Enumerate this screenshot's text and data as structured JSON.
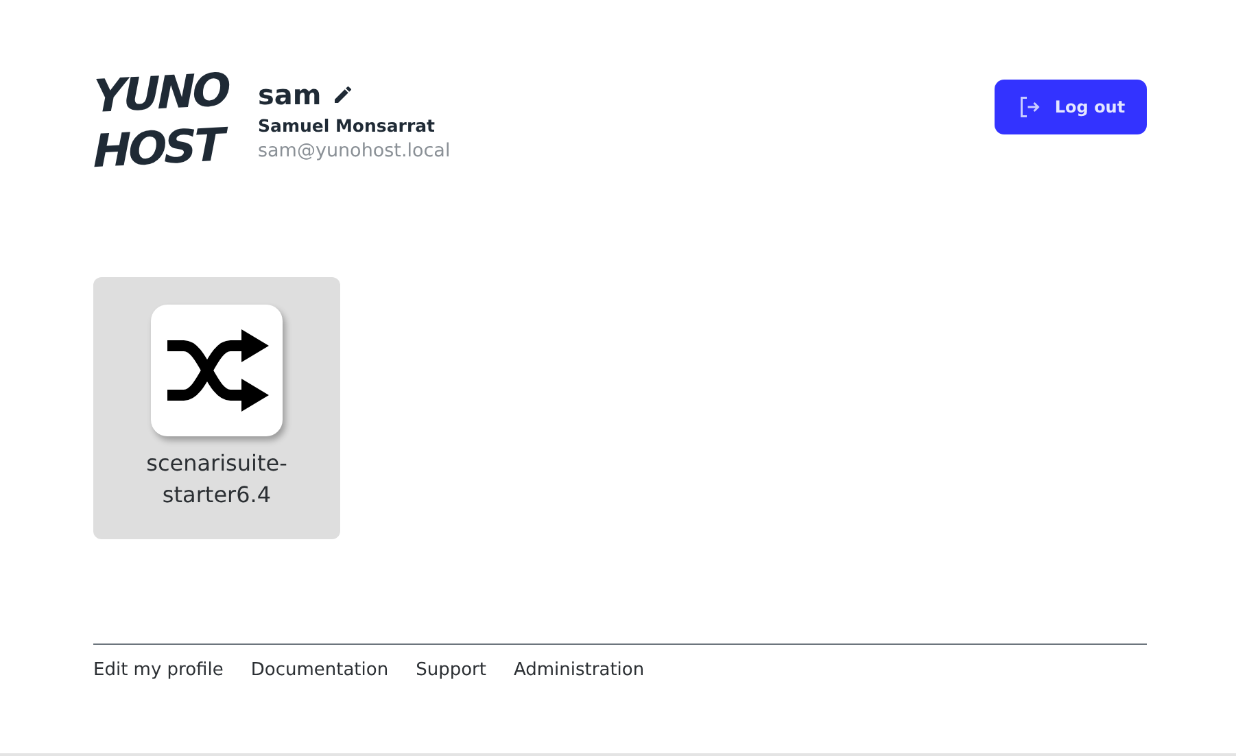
{
  "logo": [
    "YUNO",
    "HOST"
  ],
  "user": {
    "username": "sam",
    "full_name": "Samuel Monsarrat",
    "email": "sam@yunohost.local"
  },
  "logout_button": "Log out",
  "apps": [
    {
      "label": "scenarisuite-starter6.4"
    }
  ],
  "footer_links": [
    "Edit my profile",
    "Documentation",
    "Support",
    "Administration"
  ]
}
